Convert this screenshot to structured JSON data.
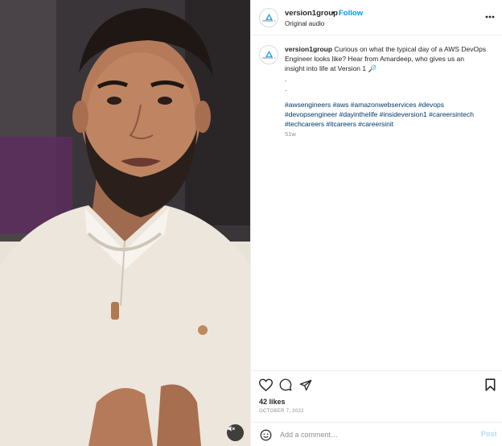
{
  "colors": {
    "accent": "#0095f6",
    "hashtag": "#00376b",
    "muted": "#8e8e8e",
    "post_disabled": "#b3dbff"
  },
  "header": {
    "username": "version1group",
    "separator": "•",
    "follow_label": "Follow",
    "audio_label": "Original audio",
    "avatar_text": "VERSION 1",
    "more_icon": "more-horizontal-icon"
  },
  "caption": {
    "username": "version1group",
    "line1": "Curious on what the typical day of a AWS DevOps",
    "line2": "Engineer looks like? Hear from Amardeep, who gives us an",
    "line3": "insight into life at Version 1",
    "line3_emoji": "🔎",
    "dot1": ".",
    "dot2": ".",
    "dot3": ".",
    "hashtags": [
      "#awsengineers",
      "#aws",
      "#amazonwebservices",
      "#devops",
      "#devopsengineer",
      "#dayinthelife",
      "#insideversion1",
      "#careersintech",
      "#techcareers",
      "#itcareers",
      "#careersinit"
    ],
    "age": "51w"
  },
  "actions": {
    "like_icon": "heart-icon",
    "comment_icon": "comment-icon",
    "share_icon": "share-icon",
    "save_icon": "bookmark-icon"
  },
  "likes": "42 likes",
  "date": "OCTOBER 7, 2022",
  "comment": {
    "placeholder": "Add a comment…",
    "value": "",
    "post_label": "Post",
    "emoji_icon": "emoji-icon"
  },
  "media": {
    "mute_icon": "speaker-muted-icon"
  }
}
